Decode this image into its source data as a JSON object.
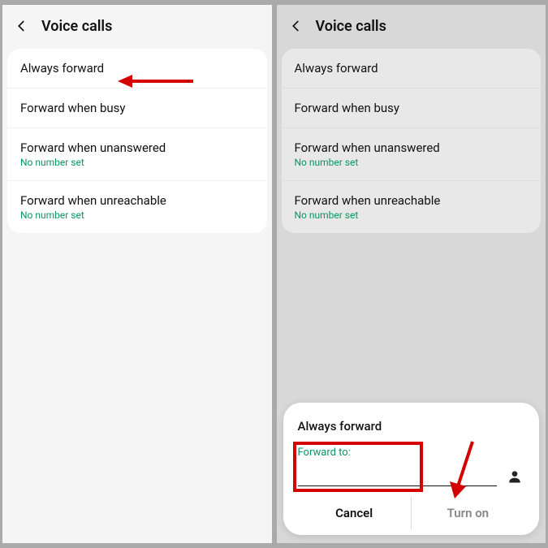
{
  "left": {
    "title": "Voice calls",
    "items": [
      {
        "label": "Always forward",
        "sub": ""
      },
      {
        "label": "Forward when busy",
        "sub": ""
      },
      {
        "label": "Forward when unanswered",
        "sub": "No number set"
      },
      {
        "label": "Forward when unreachable",
        "sub": "No number set"
      }
    ]
  },
  "right": {
    "title": "Voice calls",
    "items": [
      {
        "label": "Always forward",
        "sub": ""
      },
      {
        "label": "Forward when busy",
        "sub": ""
      },
      {
        "label": "Forward when unanswered",
        "sub": "No number set"
      },
      {
        "label": "Forward when unreachable",
        "sub": "No number set"
      }
    ],
    "modal": {
      "title": "Always forward",
      "input_label": "Forward to:",
      "cancel": "Cancel",
      "turnon": "Turn on"
    }
  }
}
